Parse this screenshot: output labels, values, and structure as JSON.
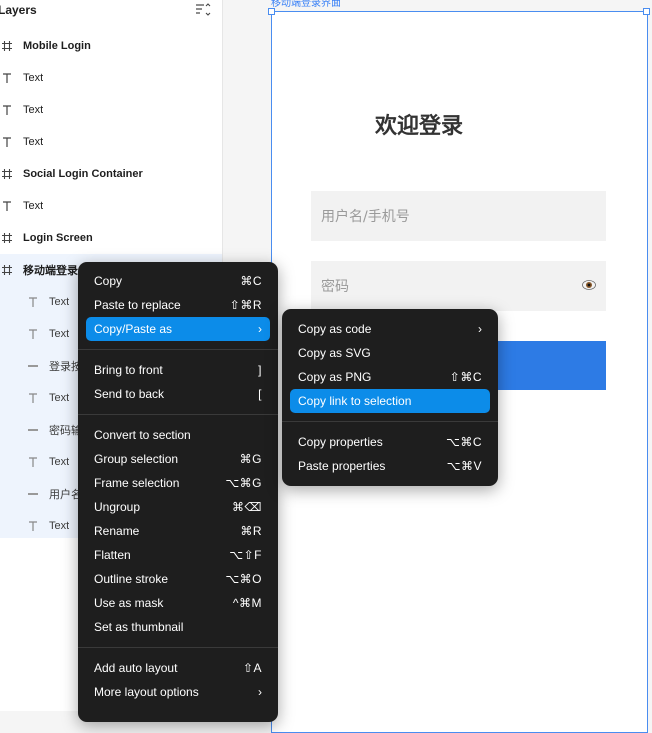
{
  "layers": {
    "title": "Layers",
    "items": [
      {
        "type": "frame",
        "label": "Mobile Login",
        "bold": true
      },
      {
        "type": "text",
        "label": "Text"
      },
      {
        "type": "text",
        "label": "Text"
      },
      {
        "type": "text",
        "label": "Text"
      },
      {
        "type": "frame",
        "label": "Social Login Container",
        "bold": true
      },
      {
        "type": "text",
        "label": "Text"
      },
      {
        "type": "frame",
        "label": "Login Screen",
        "bold": true
      },
      {
        "type": "frame",
        "label": "移动端登录界面",
        "bold": true
      },
      {
        "type": "text",
        "label": "Text"
      },
      {
        "type": "text",
        "label": "Text"
      },
      {
        "type": "rect",
        "label": "登录按钮"
      },
      {
        "type": "text",
        "label": "Text"
      },
      {
        "type": "rect",
        "label": "密码输入框"
      },
      {
        "type": "text",
        "label": "Text"
      },
      {
        "type": "rect",
        "label": "用户名输入框"
      },
      {
        "type": "text",
        "label": "Text"
      }
    ]
  },
  "canvas": {
    "frame_label": "移动端登录界面",
    "login_title": "欢迎登录",
    "username_placeholder": "用户名/手机号",
    "password_placeholder": "密码",
    "eye_icon": "eye-icon"
  },
  "context_menu": {
    "items": [
      {
        "label": "Copy",
        "shortcut": "⌘C"
      },
      {
        "label": "Paste to replace",
        "shortcut": "⇧⌘R"
      },
      {
        "label": "Copy/Paste as",
        "shortcut": "›",
        "active": true
      },
      {
        "label": "Bring to front",
        "shortcut": "]"
      },
      {
        "label": "Send to back",
        "shortcut": "["
      },
      {
        "label": "Convert to section",
        "shortcut": ""
      },
      {
        "label": "Group selection",
        "shortcut": "⌘G"
      },
      {
        "label": "Frame selection",
        "shortcut": "⌥⌘G"
      },
      {
        "label": "Ungroup",
        "shortcut": "⌘⌫"
      },
      {
        "label": "Rename",
        "shortcut": "⌘R"
      },
      {
        "label": "Flatten",
        "shortcut": "⌥⇧F"
      },
      {
        "label": "Outline stroke",
        "shortcut": "⌥⌘O"
      },
      {
        "label": "Use as mask",
        "shortcut": "^⌘M"
      },
      {
        "label": "Set as thumbnail",
        "shortcut": ""
      },
      {
        "label": "Add auto layout",
        "shortcut": "⇧A"
      },
      {
        "label": "More layout options",
        "shortcut": "›"
      }
    ]
  },
  "submenu": {
    "items": [
      {
        "label": "Copy as code",
        "shortcut": "›"
      },
      {
        "label": "Copy as SVG",
        "shortcut": ""
      },
      {
        "label": "Copy as PNG",
        "shortcut": "⇧⌘C"
      },
      {
        "label": "Copy link to selection",
        "shortcut": "",
        "active": true
      },
      {
        "label": "Copy properties",
        "shortcut": "⌥⌘C"
      },
      {
        "label": "Paste properties",
        "shortcut": "⌥⌘V"
      }
    ]
  },
  "colors": {
    "accent": "#0c8ce9",
    "menu_bg": "#1e1e1e",
    "login_button": "#2d7be5",
    "selection_bg": "#eef4fd"
  }
}
